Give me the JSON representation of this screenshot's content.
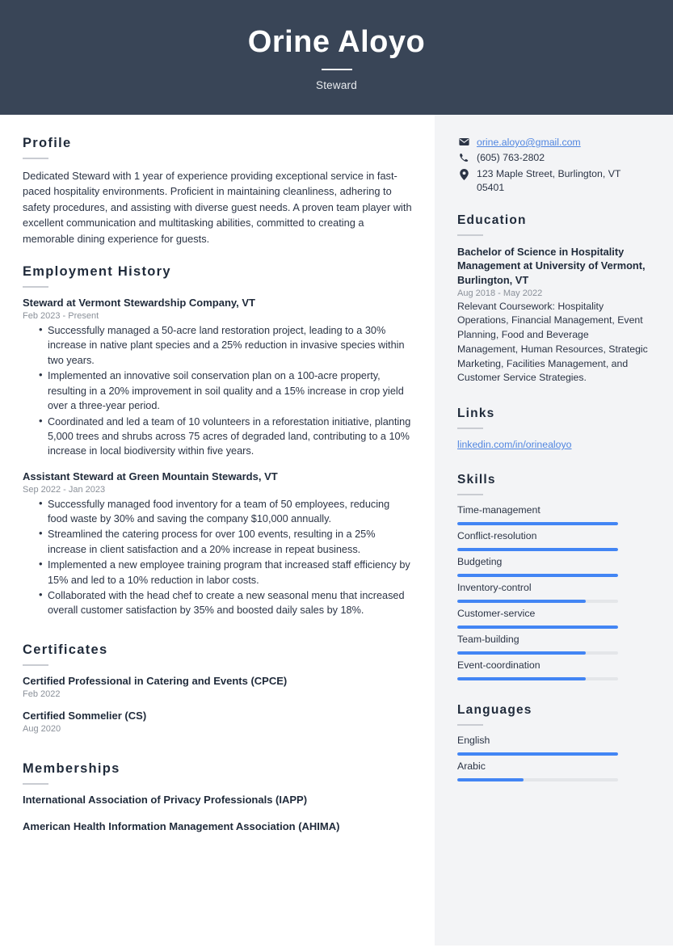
{
  "header": {
    "name": "Orine Aloyo",
    "job_title": "Steward",
    "bg_color": "#394557"
  },
  "accent_color": "#4285f4",
  "link_color": "#5186e0",
  "main": {
    "profile": {
      "heading": "Profile",
      "text": "Dedicated Steward with 1 year of experience providing exceptional service in fast-paced hospitality environments. Proficient in maintaining cleanliness, adhering to safety procedures, and assisting with diverse guest needs. A proven team player with excellent communication and multitasking abilities, committed to creating a memorable dining experience for guests."
    },
    "employment": {
      "heading": "Employment History",
      "jobs": [
        {
          "title": "Steward at Vermont Stewardship Company, VT",
          "dates": "Feb 2023 - Present",
          "bullets": [
            "Successfully managed a 50-acre land restoration project, leading to a 30% increase in native plant species and a 25% reduction in invasive species within two years.",
            "Implemented an innovative soil conservation plan on a 100-acre property, resulting in a 20% improvement in soil quality and a 15% increase in crop yield over a three-year period.",
            "Coordinated and led a team of 10 volunteers in a reforestation initiative, planting 5,000 trees and shrubs across 75 acres of degraded land, contributing to a 10% increase in local biodiversity within five years."
          ]
        },
        {
          "title": "Assistant Steward at Green Mountain Stewards, VT",
          "dates": "Sep 2022 - Jan 2023",
          "bullets": [
            "Successfully managed food inventory for a team of 50 employees, reducing food waste by 30% and saving the company $10,000 annually.",
            "Streamlined the catering process for over 100 events, resulting in a 25% increase in client satisfaction and a 20% increase in repeat business.",
            "Implemented a new employee training program that increased staff efficiency by 15% and led to a 10% reduction in labor costs.",
            "Collaborated with the head chef to create a new seasonal menu that increased overall customer satisfaction by 35% and boosted daily sales by 18%."
          ]
        }
      ]
    },
    "certificates": {
      "heading": "Certificates",
      "items": [
        {
          "title": "Certified Professional in Catering and Events (CPCE)",
          "date": "Feb 2022"
        },
        {
          "title": "Certified Sommelier (CS)",
          "date": "Aug 2020"
        }
      ]
    },
    "memberships": {
      "heading": "Memberships",
      "items": [
        {
          "title": "International Association of Privacy Professionals (IAPP)"
        },
        {
          "title": "American Health Information Management Association (AHIMA)"
        }
      ]
    }
  },
  "sidebar": {
    "contact": [
      {
        "icon": "envelope-icon",
        "text": "orine.aloyo@gmail.com",
        "is_link": true
      },
      {
        "icon": "phone-icon",
        "text": "(605) 763-2802",
        "is_link": false
      },
      {
        "icon": "location-pin-icon",
        "text": "123 Maple Street, Burlington, VT 05401",
        "is_link": false
      }
    ],
    "education": {
      "heading": "Education",
      "degree": "Bachelor of Science in Hospitality Management at University of Vermont, Burlington, VT",
      "dates": "Aug 2018 - May 2022",
      "description": "Relevant Coursework: Hospitality Operations, Financial Management, Event Planning, Food and Beverage Management, Human Resources, Strategic Marketing, Facilities Management, and Customer Service Strategies."
    },
    "links": {
      "heading": "Links",
      "items": [
        {
          "label": "linkedin.com/in/orinealoyo"
        }
      ]
    },
    "skills": {
      "heading": "Skills",
      "items": [
        {
          "label": "Time-management",
          "level": 100
        },
        {
          "label": "Conflict-resolution",
          "level": 100
        },
        {
          "label": "Budgeting",
          "level": 100
        },
        {
          "label": "Inventory-control",
          "level": 80
        },
        {
          "label": "Customer-service",
          "level": 100
        },
        {
          "label": "Team-building",
          "level": 80
        },
        {
          "label": "Event-coordination",
          "level": 80
        }
      ]
    },
    "languages": {
      "heading": "Languages",
      "items": [
        {
          "label": "English",
          "level": 100
        },
        {
          "label": "Arabic",
          "level": 41
        }
      ]
    }
  }
}
